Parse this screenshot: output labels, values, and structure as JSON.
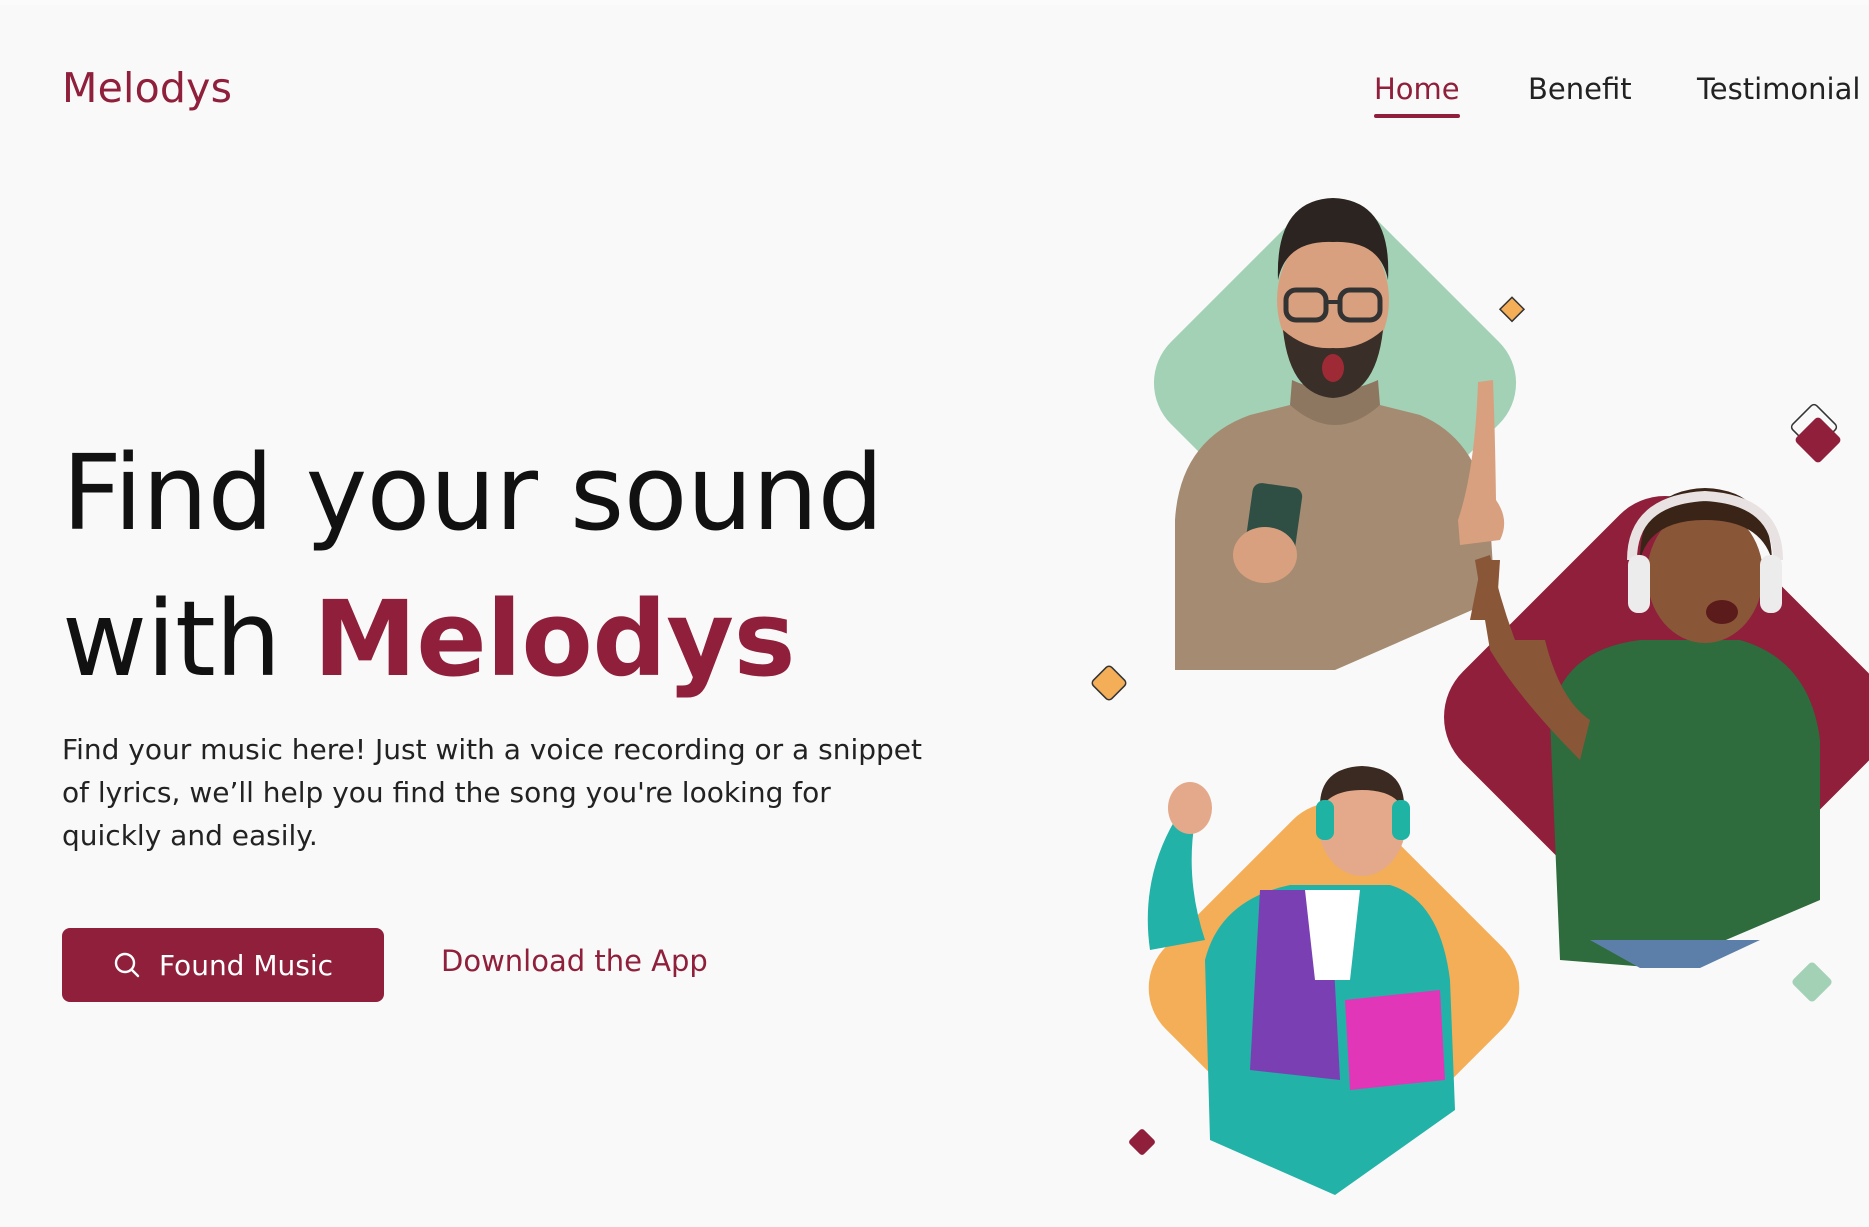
{
  "brand": {
    "name": "Melodys"
  },
  "nav": {
    "items": [
      {
        "label": "Home",
        "active": true
      },
      {
        "label": "Benefit",
        "active": false
      },
      {
        "label": "Testimonial",
        "active": false
      }
    ]
  },
  "hero": {
    "title_line1": "Find your sound",
    "title_line2_prefix": "with ",
    "title_line2_accent": "Melodys",
    "description": "Find your music here! Just with a voice recording or a snippet of lyrics, we’ll help you find the song you're looking for quickly and easily.",
    "primary_button": "Found Music",
    "secondary_link": "Download the App"
  },
  "colors": {
    "brand": "#8f1f3a",
    "green": "#a3d1b5",
    "orange": "#f4ae57",
    "background": "#f9f9f9"
  },
  "icons": {
    "primary_button_icon": "search-icon"
  }
}
